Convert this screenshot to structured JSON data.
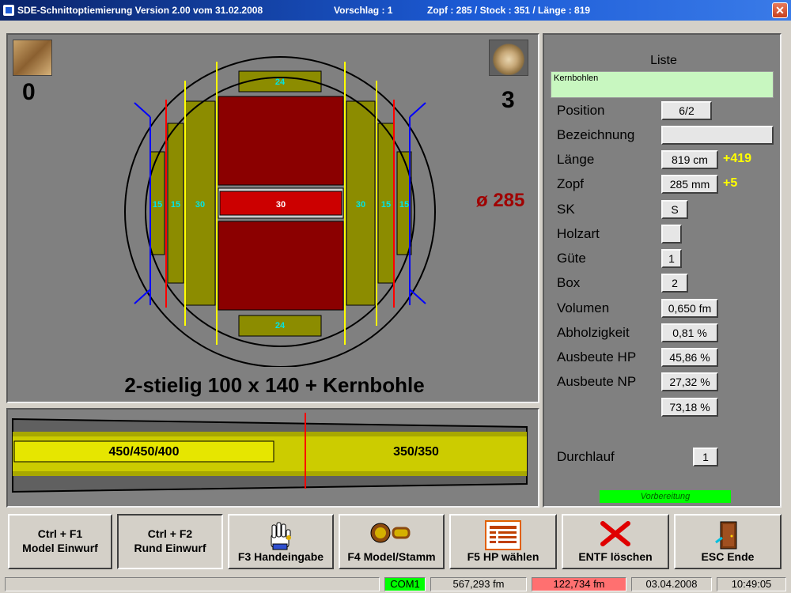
{
  "titlebar": {
    "app_title": "SDE-Schnittoptiemierung  Version 2.00 vom 31.02.2008",
    "proposal": "Vorschlag : 1",
    "summary": "Zopf : 285  /  Stock : 351  /  Länge : 819",
    "close_label": "✕"
  },
  "graphic": {
    "left_count": "0",
    "right_count": "3",
    "diameter": "ø 285",
    "caption": "2-stielig 100 x 140 + Kernbohle",
    "labels": {
      "top": "24",
      "bottom": "24",
      "center": "30",
      "left_outer": "15",
      "left_mid": "15",
      "left_inner": "30",
      "right_inner": "30",
      "right_mid": "15",
      "right_outer": "15"
    }
  },
  "log": {
    "left_section": "450/450/400",
    "right_section": "350/350"
  },
  "info": {
    "title": "Liste",
    "list_entry": "Kernbohlen",
    "rows": [
      {
        "label": "Position",
        "value": "6/2",
        "delta": ""
      },
      {
        "label": "Bezeichnung",
        "value": "",
        "delta": ""
      },
      {
        "label": "Länge",
        "value": "819 cm",
        "delta": "+419"
      },
      {
        "label": "Zopf",
        "value": "285 mm",
        "delta": "+5"
      },
      {
        "label": "SK",
        "value": "S",
        "delta": ""
      },
      {
        "label": "Holzart",
        "value": "",
        "delta": ""
      },
      {
        "label": "Güte",
        "value": "1",
        "delta": ""
      },
      {
        "label": "Box",
        "value": "2",
        "delta": ""
      },
      {
        "label": "Volumen",
        "value": "0,650 fm",
        "delta": ""
      },
      {
        "label": "Abholzigkeit",
        "value": "0,81 %",
        "delta": ""
      },
      {
        "label": "Ausbeute HP",
        "value": "45,86 %",
        "delta": ""
      },
      {
        "label": "Ausbeute NP",
        "value": "27,32 %",
        "delta": ""
      },
      {
        "label": "",
        "value": "73,18 %",
        "delta": ""
      }
    ],
    "durchlauf_label": "Durchlauf",
    "durchlauf_value": "1",
    "status": "Vorbereitung"
  },
  "buttons": [
    {
      "line1": "Ctrl + F1",
      "line2": "Model Einwurf",
      "icon": ""
    },
    {
      "line1": "Ctrl + F2",
      "line2": "Rund Einwurf",
      "icon": ""
    },
    {
      "label": "F3 Handeingabe",
      "icon": "hand-icon"
    },
    {
      "label": "F4 Model/Stamm",
      "icon": "logs-icon"
    },
    {
      "label": "F5 HP wählen",
      "icon": "list-icon"
    },
    {
      "label": "ENTF löschen",
      "icon": "delete-x-icon"
    },
    {
      "label": "ESC Ende",
      "icon": "exit-door-icon"
    }
  ],
  "statusbar": {
    "port": "COM1",
    "volume1": "567,293 fm",
    "volume2": "122,734 fm",
    "date": "03.04.2008",
    "time": "10:49:05"
  },
  "colors": {
    "board_olive": "#8c8c00",
    "core_red": "#8b0000",
    "core_center": "#cc0000",
    "cut_red": "#ff0000",
    "cut_yellow": "#ffff00",
    "cut_blue": "#0000ff",
    "label_cyan": "#00e5e5",
    "status_green": "#00ff00",
    "status_red": "#ff7070"
  }
}
